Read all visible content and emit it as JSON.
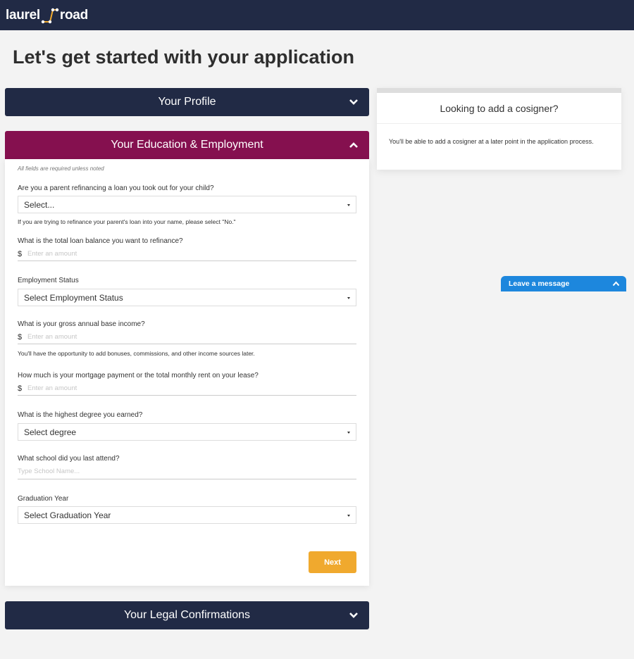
{
  "brand": {
    "logo_left": "laurel",
    "logo_right": "road",
    "nav_bg": "#212a45",
    "accent_gold": "#f0a92e",
    "accent_plum": "#85104f"
  },
  "page": {
    "title": "Let's get started with your application"
  },
  "panels": {
    "profile": {
      "label": "Your Profile",
      "state": "collapsed"
    },
    "education": {
      "label": "Your Education & Employment",
      "state": "expanded"
    },
    "legal": {
      "label": "Your Legal Confirmations",
      "state": "collapsed"
    }
  },
  "form": {
    "required_note": "All fields are required unless noted",
    "parent_refi": {
      "label": "Are you a parent refinancing a loan you took out for your child?",
      "value": "Select...",
      "help": "If you are trying to refinance your parent's loan into your name, please select \"No.\""
    },
    "loan_balance": {
      "label": "What is the total loan balance you want to refinance?",
      "prefix": "$",
      "placeholder": "Enter an amount",
      "value": ""
    },
    "employment_status": {
      "label": "Employment Status",
      "value": "Select Employment Status"
    },
    "gross_income": {
      "label": "What is your gross annual base income?",
      "prefix": "$",
      "placeholder": "Enter an amount",
      "value": "",
      "help": "You'll have the opportunity to add bonuses, commissions, and other income sources later."
    },
    "housing_payment": {
      "label": "How much is your mortgage payment or the total monthly rent on your lease?",
      "prefix": "$",
      "placeholder": "Enter an amount",
      "value": ""
    },
    "degree": {
      "label": "What is the highest degree you earned?",
      "value": "Select degree"
    },
    "school": {
      "label": "What school did you last attend?",
      "placeholder": "Type School Name...",
      "value": ""
    },
    "grad_year": {
      "label": "Graduation Year",
      "value": "Select Graduation Year"
    },
    "next_label": "Next"
  },
  "cosigner": {
    "title": "Looking to add a cosigner?",
    "body": "You'll be able to add a cosigner at a later point in the application process."
  },
  "chat": {
    "label": "Leave a message"
  }
}
